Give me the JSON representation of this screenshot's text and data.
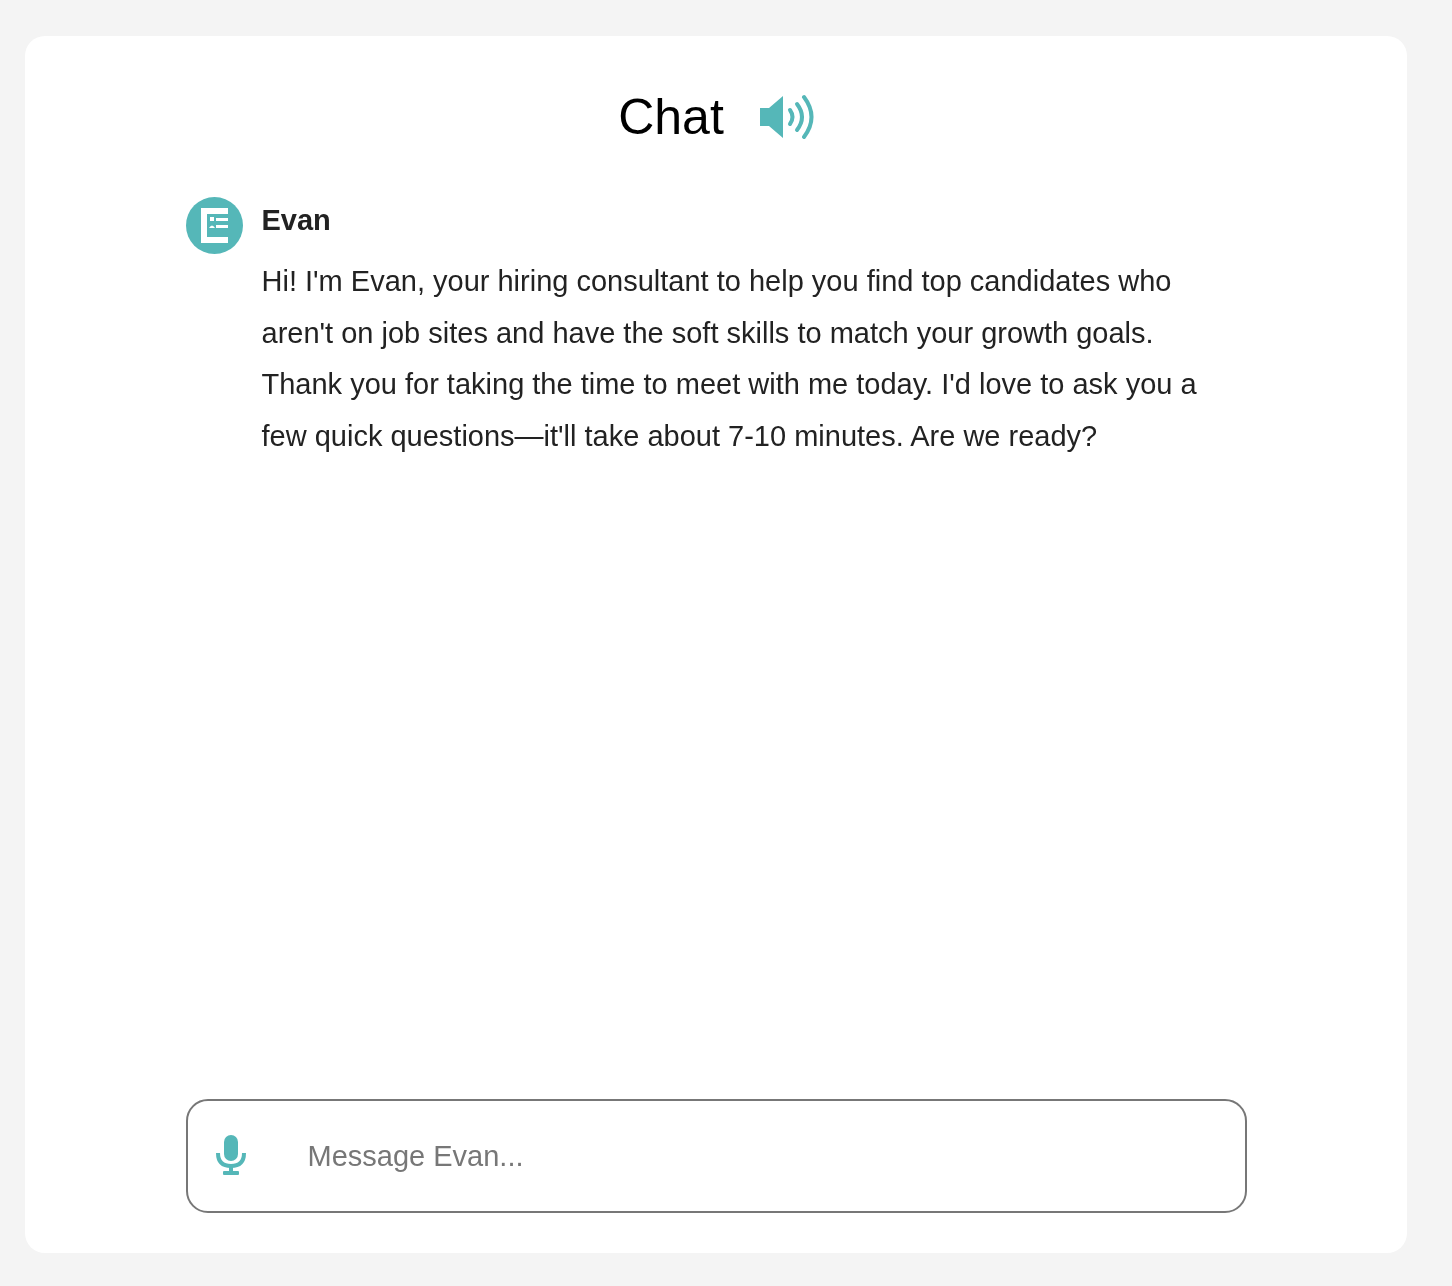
{
  "header": {
    "title": "Chat"
  },
  "messages": [
    {
      "sender": "Evan",
      "text": "Hi! I'm Evan, your hiring consultant to help you find top candidates who aren't on job sites and have the soft skills to match your growth goals. Thank you for taking the time to meet with me today. I'd love to ask you a few quick questions—it'll take about 7-10 minutes. Are we ready?"
    }
  ],
  "composer": {
    "placeholder": "Message Evan..."
  }
}
